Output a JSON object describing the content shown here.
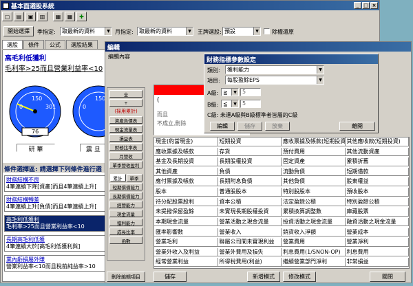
{
  "main": {
    "title": "基本面選股系統",
    "toolbar": {
      "start_button": "開始選擇",
      "quarter_label": "季指定:",
      "quarter_value": "取最新的資料",
      "month_label": "月指定:",
      "month_value": "取最新的資料",
      "wangpai_label": "王牌選股:",
      "wangpai_value": "預設",
      "exclude_label": "除權還原"
    },
    "tabs": [
      "選股",
      "條件",
      "公式",
      "選股結果"
    ],
    "condition_title": "高毛利低獲利",
    "condition_formula": "毛利率>25而且營業利益率<10",
    "gauges": [
      {
        "ticks": [
          "0",
          "150",
          "301"
        ],
        "value": "76",
        "label": "研   華",
        "needle_fraction": 0.25
      },
      {
        "ticks": [
          "0",
          "150"
        ],
        "label": "震 旦"
      }
    ],
    "prompt_text": "條件選擇區: 請選擇下列條件進行選",
    "conditions": [
      {
        "title": "財務結構不良",
        "line1": "4筆連續下降[資產]而且4筆連續上升[",
        "selected": false
      },
      {
        "title": "財務結構轉差",
        "line1": "4筆連續上升[負債]而且4筆連續上升[",
        "selected": false
      },
      {
        "title": "高毛利低獲利",
        "line1": "毛利率>25而且營業利益率<10",
        "selected": true
      },
      {
        "title": "長期高毛利低獲",
        "line1": "4筆連續大於[高毛利低獲利與]",
        "selected": false
      },
      {
        "title": "業內虧損屬外賺",
        "line1": "營業利益率<10而且稅前純益率>10",
        "selected": false
      }
    ]
  },
  "editor": {
    "title": "編輯",
    "content_label": "編輯內容",
    "left_buttons": [
      "全",
      "+",
      "(採用累計)",
      "資產負債表",
      "現金流量表",
      "損益表",
      "財務比率表",
      "月營收",
      "單季營收盈利"
    ],
    "small_tabs": [
      "累計",
      "單季"
    ],
    "left_buttons2": [
      "短期償債能力",
      "長期償債能力",
      "經營能力",
      "現金流量",
      "獲利能力",
      "成長比率",
      "函數"
    ],
    "delete_button": "刪除編輯項目",
    "editor_lines": [
      "(",
      "而且",
      "不成立,刪除"
    ],
    "grid_cells": [
      "現金(約當現金)",
      "短期投資",
      "應收票據及帳款(短期投資)",
      "其他應收款(短期投資)",
      "應收票據及帳款",
      "存貨",
      "預付費用",
      "其他流動資產",
      "基金及長期投資",
      "長期股權投資",
      "固定資產",
      "累積折舊",
      "其他資產",
      "負債",
      "流動負債",
      "短期借款",
      "應付票據及帳款",
      "長期附息負債",
      "其他負債",
      "股東權益",
      "股本",
      "普通股股本",
      "特別股股本",
      "預收股本",
      "待分配股票股利",
      "資本公積",
      "法定盈餘公積",
      "特別盈餘公積",
      "未提撥保留盈餘",
      "未實現長期股權投資",
      "累積換算調整數",
      "庫藏股票",
      "本期現金流量",
      "營業活動之現金流量",
      "投資活動之現金流量",
      "融資活動之現金流量",
      "匯率影響數",
      "營業收入",
      "銷貨收入淨額",
      "營業成本",
      "營業毛利",
      "聯屬公司間未實現利益",
      "營業費用",
      "營業淨利",
      "營業外收入及利益",
      "營業外費用及損失",
      "利息費用(1/SNON-OP)",
      "利息費用",
      "經常營業利益",
      "所得稅費用(利益)",
      "繼續營業部門淨利",
      "非常損益"
    ],
    "bottom_buttons": {
      "save": "儲存",
      "new_mode": "新增模式",
      "modify_mode": "修改模式",
      "close": "關閉"
    }
  },
  "dialog": {
    "title": "財務指標參數設定",
    "category_label": "類別:",
    "category_value": "獲利能力",
    "item_label": "項目:",
    "item_value": "每股盈餘EPS",
    "a_label": "A級:",
    "a_op": "≧",
    "a_value": "5",
    "b_label": "B級:",
    "b_op": "≦",
    "b_value": "5",
    "c_note": "C級: 未達A級與B級標準者皆屬的C級",
    "edit_button": "編輯",
    "save_button": "儲存",
    "discard_button": "放棄",
    "leave_button": "離開"
  }
}
